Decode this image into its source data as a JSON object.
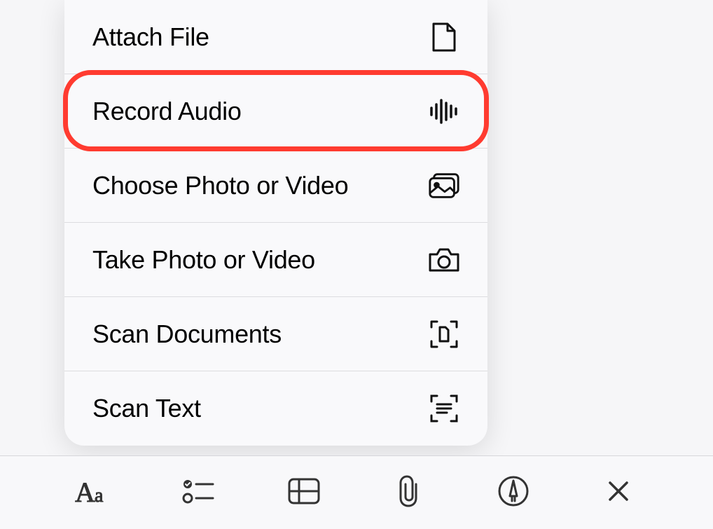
{
  "menu": {
    "items": [
      {
        "label": "Attach File",
        "icon": "document-icon"
      },
      {
        "label": "Record Audio",
        "icon": "waveform-icon"
      },
      {
        "label": "Choose Photo or Video",
        "icon": "photo-icon"
      },
      {
        "label": "Take Photo or Video",
        "icon": "camera-icon"
      },
      {
        "label": "Scan Documents",
        "icon": "scan-document-icon"
      },
      {
        "label": "Scan Text",
        "icon": "scan-text-icon"
      }
    ],
    "highlighted_index": 1
  },
  "toolbar": {
    "items": [
      {
        "icon": "text-format-icon"
      },
      {
        "icon": "checklist-icon"
      },
      {
        "icon": "table-icon"
      },
      {
        "icon": "attachment-icon"
      },
      {
        "icon": "markup-icon"
      },
      {
        "icon": "close-icon"
      }
    ]
  },
  "colors": {
    "highlight": "#ff3b30"
  }
}
